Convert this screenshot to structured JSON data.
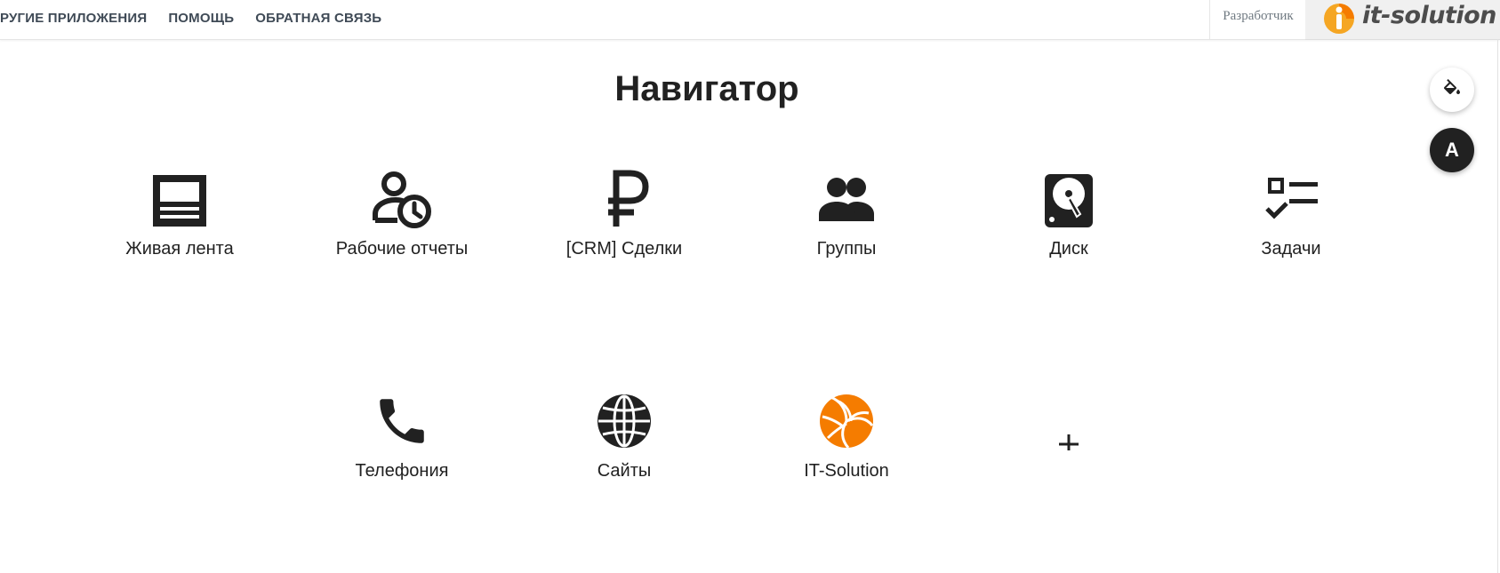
{
  "header": {
    "nav": [
      {
        "label": "РУГИЕ ПРИЛОЖЕНИЯ"
      },
      {
        "label": "ПОМОЩЬ"
      },
      {
        "label": "ОБРАТНАЯ СВЯЗЬ"
      }
    ],
    "developer_label": "Разработчик",
    "logo_text": "it-solution"
  },
  "main": {
    "title": "Навигатор",
    "tiles": [
      {
        "label": "Живая лента",
        "icon": "newspaper-icon"
      },
      {
        "label": "Рабочие отчеты",
        "icon": "user-clock-icon"
      },
      {
        "label": "[CRM] Сделки",
        "icon": "ruble-icon"
      },
      {
        "label": "Группы",
        "icon": "people-icon"
      },
      {
        "label": "Диск",
        "icon": "harddisk-icon"
      },
      {
        "label": "Задачи",
        "icon": "checklist-icon"
      },
      {
        "label": "Телефония",
        "icon": "phone-icon"
      },
      {
        "label": "Сайты",
        "icon": "globe-icon"
      },
      {
        "label": "IT-Solution",
        "icon": "volleyball-icon"
      },
      {
        "label": "",
        "icon": "plus-icon"
      }
    ]
  },
  "fabs": {
    "theme_icon": "paint-bucket-icon",
    "avatar_letter": "A"
  },
  "colors": {
    "text": "#212121",
    "nav_text": "#3f4a56",
    "brand_orange": "#f57c00",
    "logo_bg": "#f0f0f0"
  }
}
